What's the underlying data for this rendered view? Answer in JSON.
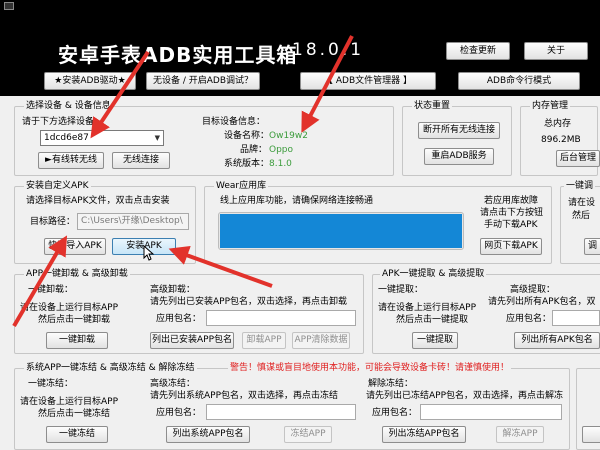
{
  "header": {
    "title": "安卓手表ADB实用工具箱",
    "version": "18.0.1",
    "check_update": "检查更新",
    "about": "关于",
    "btn_wireless_adb": "★安装ADB驱动★",
    "btn_no_device": "无设备 / 开启ADB调试？",
    "btn_adb_file_manager": "【  ADB文件管理器  】",
    "btn_adb_cmd": "ADB命令行模式"
  },
  "device_select": {
    "group_label": "选择设备 & 设备信息",
    "prompt": "请于下方选择设备",
    "selected_device": "1dcd6e87",
    "btn_usb_to_wireless": "►有线转无线",
    "btn_wireless_connect": "无线连接"
  },
  "device_info": {
    "heading": "目标设备信息：",
    "name_label": "设备名称：",
    "name_value": "Ow19w2",
    "brand_label": "品牌：",
    "brand_value": "Oppo",
    "version_label": "系统版本：",
    "version_value": "8.1.0"
  },
  "status_reset": {
    "group_label": "状态重置",
    "btn_disconnect_wireless": "断开所有无线连接",
    "btn_restart_adb": "重启ADB服务"
  },
  "memory": {
    "group_label": "内存管理",
    "total_label": "总内存",
    "total_value": "896.2MB",
    "btn_background": "后台管理"
  },
  "install_apk": {
    "group_label": "安装自定义APK",
    "instruction": "请选择目标APK文件，双击点击安装",
    "path_label": "目标路径：",
    "path_value": "C:\\Users\\开缘\\Desktop\\",
    "btn_quick_import": "快速导入APK",
    "btn_install": "安装APK"
  },
  "wear_store": {
    "group_label": "Wear应用库",
    "notice": "线上应用库功能，请确保网络连接畅通",
    "progress_percent": 100,
    "fault_line1": "若应用库故障",
    "fault_line2": "请点击下方按钮",
    "fault_line3": "手动下载APK",
    "btn_web_download": "网页下载APK"
  },
  "one_click_side": {
    "group_label": "一键调",
    "line1": "请在设",
    "line2": "然后",
    "btn": "调"
  },
  "uninstall": {
    "group_label": "APP一键卸载 & 高级卸载",
    "left_label": "一键卸载：",
    "left_line1": "请在设备上运行目标APP",
    "left_line2": "然后点击一键卸载",
    "btn_one_click": "一键卸载",
    "right_label": "高级卸载：",
    "right_instruction": "请先列出已安装APP包名，双击选择，再点击卸载",
    "pkg_label": "应用包名：",
    "btn_list": "列出已安装APP包名",
    "btn_uninstall": "卸载APP",
    "btn_clear_data": "APP清除数据"
  },
  "extract": {
    "group_label": "APK一键提取 & 高级提取",
    "left_label": "一键提取：",
    "left_line1": "请在设备上运行目标APP",
    "left_line2": "然后点击一键提取",
    "btn_one_click": "一键提取",
    "right_label": "高级提取：",
    "right_instruction": "请先列出所有APK包名，双",
    "pkg_label": "应用包名：",
    "btn_list": "列出所有APK包名"
  },
  "freeze": {
    "group_label": "系统APP一键冻结 & 高级冻结 & 解除冻结",
    "warning": "警告！慎谋或盲目地使用本功能，可能会导致设备卡砖！请谨慎使用！",
    "left_label": "一键冻结：",
    "left_line1": "请在设备上运行目标APP",
    "left_line2": "然后点击一键冻结",
    "btn_one_click": "一键冻结",
    "mid_label": "高级冻结：",
    "mid_instruction": "请先列出系统APP包名，双击选择，再点击冻结",
    "mid_pkg_label": "应用包名：",
    "btn_list_system": "列出系统APP包名",
    "btn_freeze": "冻结APP",
    "right_label": "解除冻结：",
    "right_instruction": "请先列出已冻结APP包名，双击选择，再点击解冻",
    "right_pkg_label": "应用包名：",
    "btn_list_frozen": "列出冻结APP包名",
    "btn_unfreeze": "解冻APP"
  },
  "far_right": {
    "group_label": "",
    "btn": ""
  },
  "colors": {
    "arrow": "#e2322b",
    "header_bg": "#000000",
    "accent_green": "#3c9c3c",
    "progress_blue": "#1487d6"
  }
}
